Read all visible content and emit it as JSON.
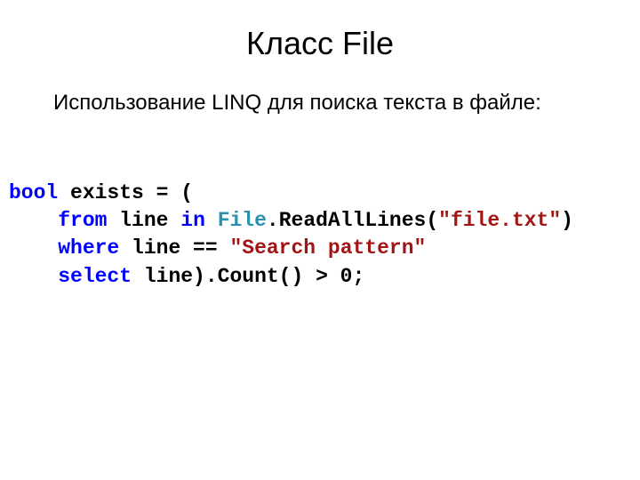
{
  "title": "Класс File",
  "subtitle": "Использование LINQ для поиска текста в файле:",
  "code": {
    "kw_bool": "bool",
    "decl": " exists = (",
    "indent": "    ",
    "kw_from": "from",
    "from_mid": " line ",
    "kw_in": "in",
    "sp": " ",
    "typ_file": "File",
    "call_read": ".ReadAllLines(",
    "str_file": "\"file.txt\"",
    "close_paren": ")",
    "kw_where": "where",
    "where_mid": " line == ",
    "str_pattern": "\"Search pattern\"",
    "kw_select": "select",
    "select_tail": " line).Count() > 0;"
  }
}
